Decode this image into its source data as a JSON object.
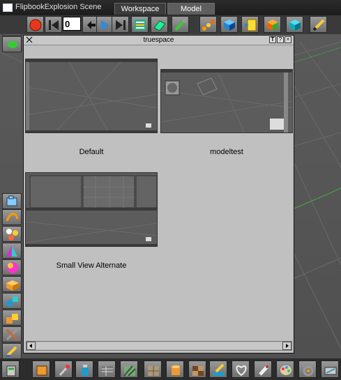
{
  "window": {
    "title": "FlipbookExplosion Scene",
    "tabs": [
      {
        "label": "Workspace",
        "active": true
      },
      {
        "label": "Model",
        "active": false
      }
    ]
  },
  "toolbar": {
    "frame_value": "0",
    "icons": [
      "record-icon",
      "go-start-icon",
      "loop-icon",
      "play-icon",
      "go-end-icon",
      "library-icon",
      "grid-icon",
      "wrench-brush-icon",
      "path-icon",
      "cube-blue-icon",
      "cube-yellow-icon",
      "cube-orange-icon",
      "cube-teal-icon",
      "pencil-icon"
    ]
  },
  "left_tools": {
    "icons": [
      "camera-icon",
      "rope-icon",
      "lights-icon",
      "material-icon",
      "sphere-color-icon",
      "box-open-icon",
      "shapes-icon",
      "blocks-icon",
      "tools-icon",
      "paint-icon"
    ]
  },
  "panel": {
    "title": "truespace",
    "buttons": [
      "T",
      "?",
      "×"
    ],
    "layouts": [
      {
        "label": "Default"
      },
      {
        "label": "modeltest"
      },
      {
        "label": "Small View Alternate"
      }
    ]
  },
  "bottom_bar": {
    "icons": [
      "recycle-icon",
      "box-icon",
      "pin-icon",
      "spray-icon",
      "texture-icon",
      "stripe-icon",
      "cylinder-icon",
      "checker-icon",
      "highlight-icon",
      "heart-icon",
      "bottle-icon",
      "palette-icon",
      "ring-icon",
      "render-icon"
    ]
  },
  "colors": {
    "background": "#4a4a4a",
    "panel": "#c0c0c0",
    "accent_green": "#3fae3f"
  }
}
